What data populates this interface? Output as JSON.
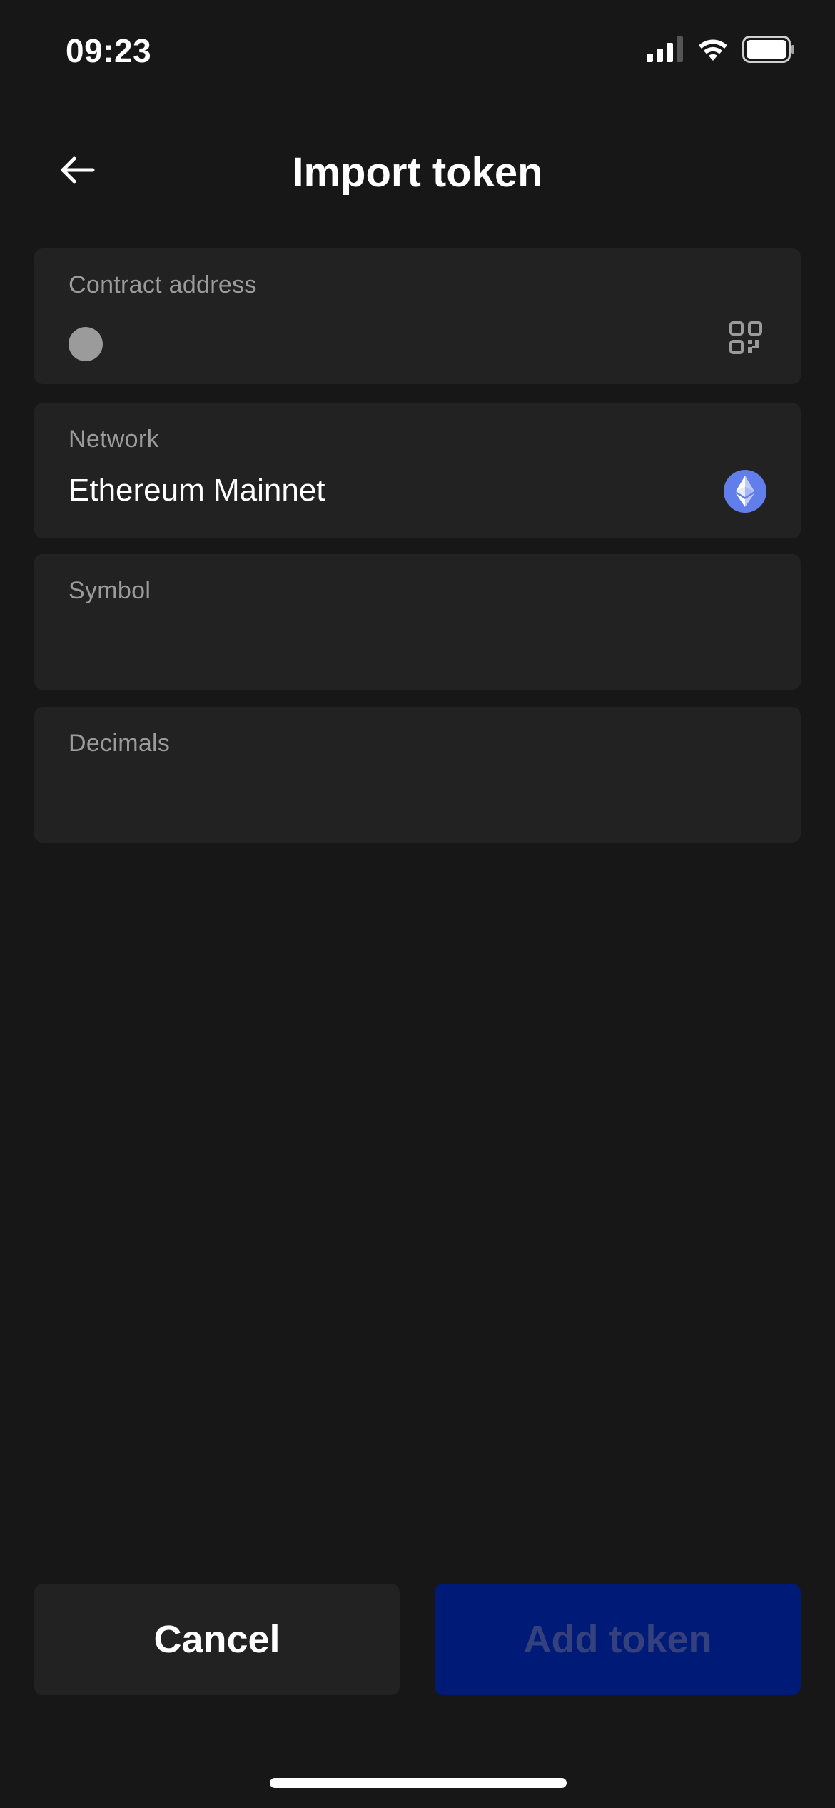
{
  "status_bar": {
    "time": "09:23",
    "icons": [
      "signal-icon",
      "wifi-icon",
      "battery-icon"
    ]
  },
  "header": {
    "title": "Import token",
    "back_icon": "arrow-left-icon"
  },
  "form": {
    "contract_address": {
      "label": "Contract address",
      "value": "",
      "icon": "qr-code-icon"
    },
    "network": {
      "label": "Network",
      "value": "Ethereum Mainnet",
      "icon": "ethereum-icon"
    },
    "symbol": {
      "label": "Symbol",
      "value": ""
    },
    "decimals": {
      "label": "Decimals",
      "value": ""
    }
  },
  "actions": {
    "cancel_label": "Cancel",
    "add_label": "Add token"
  },
  "colors": {
    "background": "#171717",
    "card": "#222222",
    "label": "#9b9b9b",
    "primary_disabled_bg": "#001a78",
    "primary_disabled_text": "#34417d",
    "ethereum": "#627eea"
  }
}
